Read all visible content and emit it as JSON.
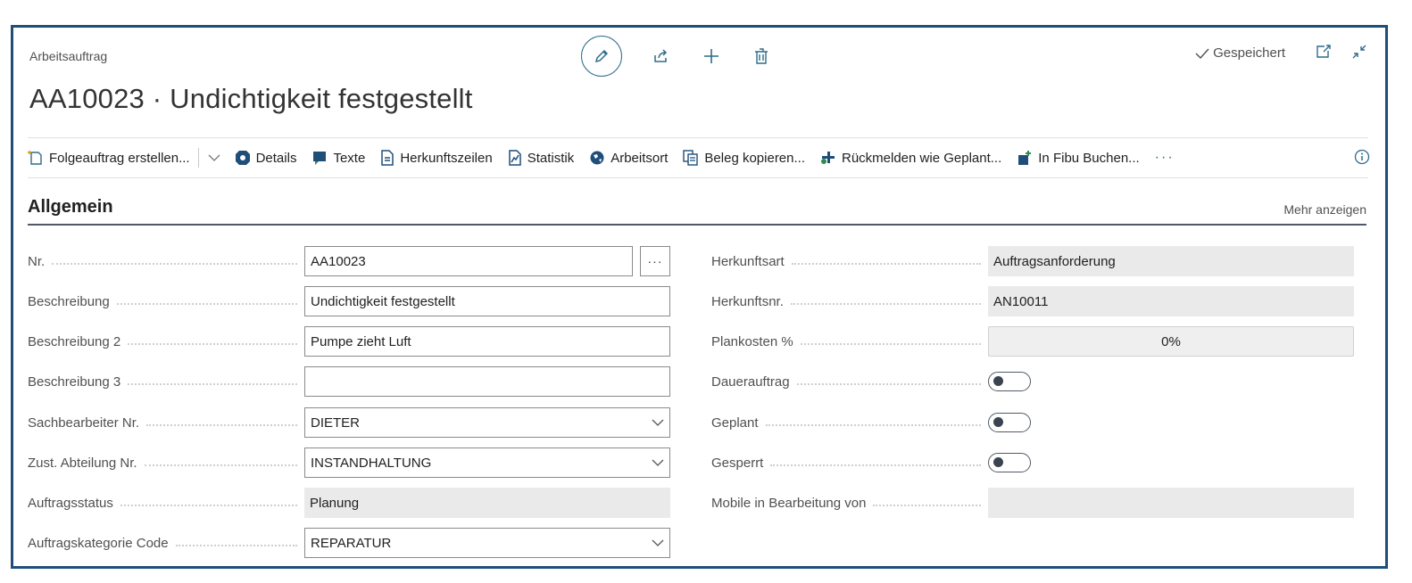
{
  "page": {
    "type_label": "Arbeitsauftrag",
    "title": "AA10023 · Undichtigkeit festgestellt",
    "saved_label": "Gespeichert",
    "icons": [
      "edit-icon",
      "share-icon",
      "add-icon",
      "delete-icon",
      "open-in-new-icon",
      "collapse-icon"
    ]
  },
  "actions": {
    "items": [
      "Folgeauftrag erstellen...",
      "Details",
      "Texte",
      "Herkunftszeilen",
      "Statistik",
      "Arbeitsort",
      "Beleg kopieren...",
      "Rückmelden wie Geplant...",
      "In Fibu Buchen..."
    ],
    "more": "···"
  },
  "section": {
    "title": "Allgemein",
    "show_more": "Mehr anzeigen"
  },
  "left_fields": [
    {
      "label": "Nr.",
      "value": "AA10023",
      "kind": "lookup"
    },
    {
      "label": "Beschreibung",
      "value": "Undichtigkeit festgestellt",
      "kind": "text"
    },
    {
      "label": "Beschreibung 2",
      "value": "Pumpe zieht Luft",
      "kind": "text"
    },
    {
      "label": "Beschreibung 3",
      "value": "",
      "kind": "text"
    },
    {
      "label": "Sachbearbeiter Nr.",
      "value": "DIETER",
      "kind": "dropdown"
    },
    {
      "label": "Zust. Abteilung Nr.",
      "value": "INSTANDHALTUNG",
      "kind": "dropdown"
    },
    {
      "label": "Auftragsstatus",
      "value": "Planung",
      "kind": "readonly"
    },
    {
      "label": "Auftragskategorie Code",
      "value": "REPARATUR",
      "kind": "dropdown"
    }
  ],
  "right_fields": [
    {
      "label": "Herkunftsart",
      "value": "Auftragsanforderung",
      "kind": "readonly"
    },
    {
      "label": "Herkunftsnr.",
      "value": "AN10011",
      "kind": "readonly"
    },
    {
      "label": "Plankosten %",
      "value": "0%",
      "kind": "percent"
    },
    {
      "label": "Dauerauftrag",
      "value": false,
      "kind": "toggle"
    },
    {
      "label": "Geplant",
      "value": false,
      "kind": "toggle"
    },
    {
      "label": "Gesperrt",
      "value": false,
      "kind": "toggle"
    },
    {
      "label": "Mobile in Bearbeitung von",
      "value": "",
      "kind": "readonly"
    }
  ]
}
